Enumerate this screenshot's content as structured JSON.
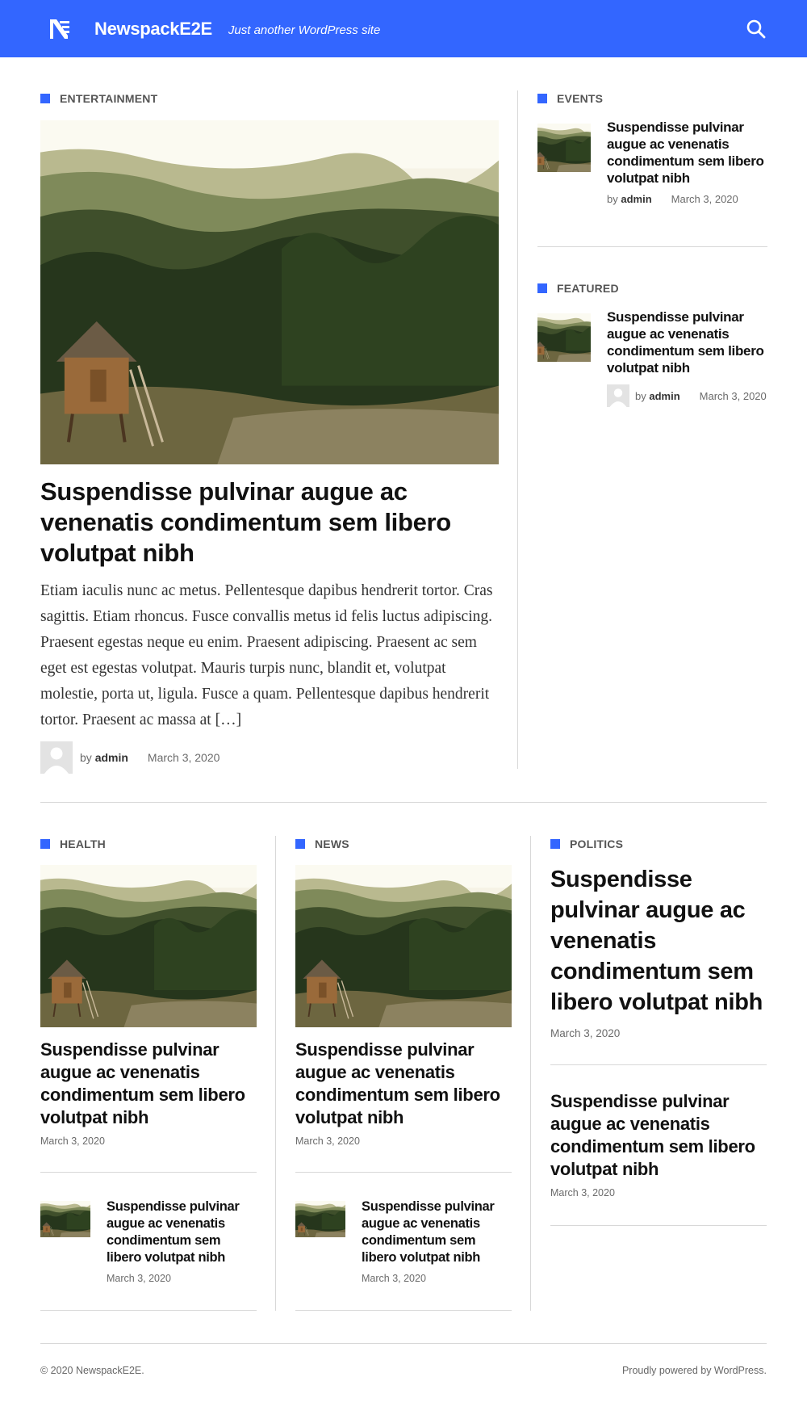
{
  "header": {
    "site_title": "NewspackE2E",
    "tagline": "Just another WordPress site",
    "logo_icon": "newspack-logo-icon",
    "search_icon": "search-icon",
    "accent_color": "#3366ff"
  },
  "top": {
    "main": {
      "category": "ENTERTAINMENT",
      "title": "Suspendisse pulvinar augue ac venenatis condimentum sem libero volutpat nibh",
      "excerpt": "Etiam iaculis nunc ac metus. Pellentesque dapibus hendrerit tortor. Cras sagittis. Etiam rhoncus. Fusce convallis metus id felis luctus adipiscing. Praesent egestas neque eu enim. Praesent adipiscing. Praesent ac sem eget est egestas volutpat. Mauris turpis nunc, blandit et, volutpat molestie, porta ut, ligula. Fusce a quam. Pellentesque dapibus hendrerit tortor. Praesent ac massa at […]",
      "by": "by",
      "author": "admin",
      "date": "March 3, 2020"
    },
    "events": {
      "category": "EVENTS",
      "title": "Suspendisse pulvinar augue ac venenatis condimentum sem libero volutpat nibh",
      "by": "by",
      "author": "admin",
      "date": "March 3, 2020"
    },
    "featured": {
      "category": "FEATURED",
      "title": "Suspendisse pulvinar augue ac venenatis condimentum sem libero volutpat nibh",
      "by": "by",
      "author": "admin",
      "date": "March 3, 2020"
    }
  },
  "bottom": {
    "health": {
      "category": "HEALTH",
      "title": "Suspendisse pulvinar augue ac venenatis condimentum sem libero volutpat nibh",
      "date": "March 3, 2020",
      "small_title": "Suspendisse pulvinar augue ac venenatis condimentum sem libero volutpat nibh",
      "small_date": "March 3, 2020"
    },
    "news": {
      "category": "NEWS",
      "title": "Suspendisse pulvinar augue ac venenatis condimentum sem libero volutpat nibh",
      "date": "March 3, 2020",
      "small_title": "Suspendisse pulvinar augue ac venenatis condimentum sem libero volutpat nibh",
      "small_date": "March 3, 2020"
    },
    "politics": {
      "category": "POLITICS",
      "title": "Suspendisse pulvinar augue ac venenatis condimentum sem libero volutpat nibh",
      "date": "March 3, 2020",
      "second_title": "Suspendisse pulvinar augue ac venenatis condimentum sem libero volutpat nibh",
      "second_date": "March 3, 2020"
    }
  },
  "footer": {
    "copyright": "© 2020 NewspackE2E.",
    "powered": "Proudly powered by WordPress."
  }
}
